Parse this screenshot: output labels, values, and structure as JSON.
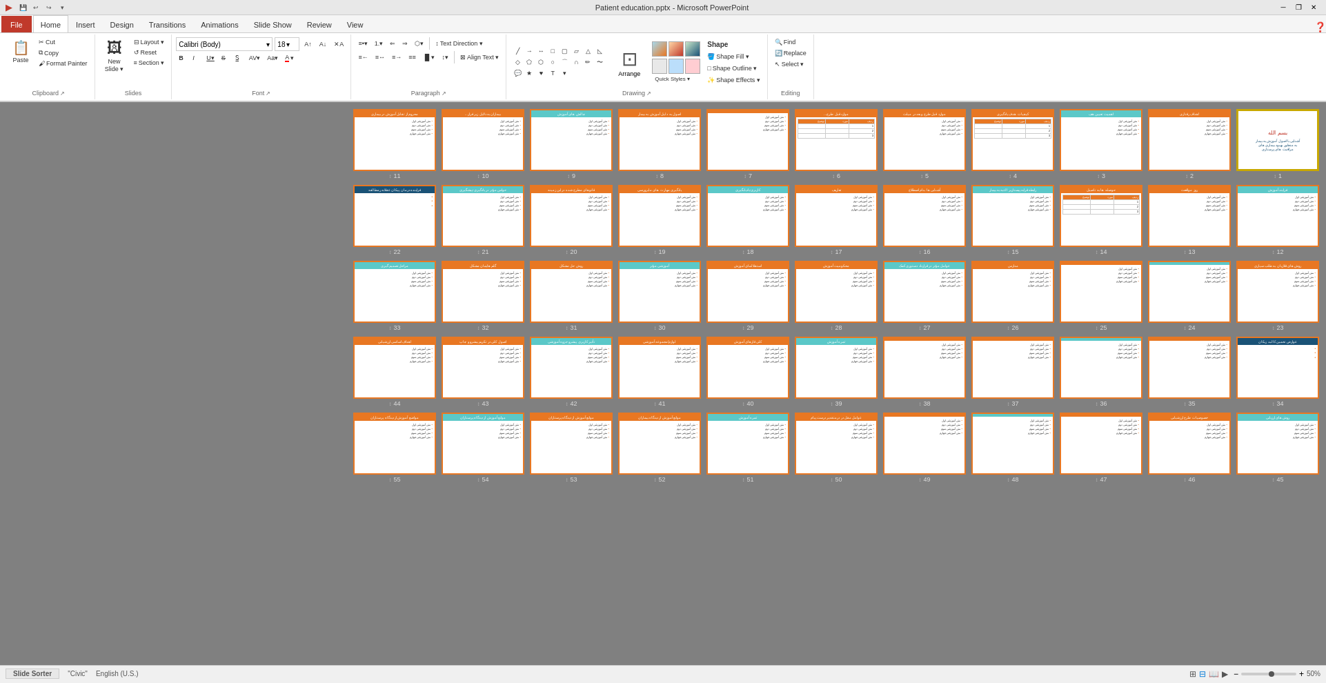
{
  "titleBar": {
    "title": "Patient education.pptx - Microsoft PowerPoint",
    "minBtn": "─",
    "maxBtn": "❐",
    "closeBtn": "✕",
    "qaButtons": [
      "💾",
      "↩",
      "↪",
      "▾"
    ]
  },
  "ribbonTabs": [
    {
      "label": "File",
      "isFile": true
    },
    {
      "label": "Home",
      "active": true
    },
    {
      "label": "Insert"
    },
    {
      "label": "Design"
    },
    {
      "label": "Transitions"
    },
    {
      "label": "Animations"
    },
    {
      "label": "Slide Show"
    },
    {
      "label": "Review"
    },
    {
      "label": "View"
    }
  ],
  "ribbon": {
    "groups": [
      {
        "name": "Clipboard",
        "items": [
          "Paste",
          "Cut",
          "Copy",
          "Format Painter"
        ]
      },
      {
        "name": "Slides",
        "items": [
          "New Slide",
          "Layout",
          "Reset",
          "Section"
        ]
      },
      {
        "name": "Font",
        "fontName": "Calibri",
        "fontSize": "18"
      },
      {
        "name": "Paragraph"
      },
      {
        "name": "Drawing"
      },
      {
        "name": "Editing",
        "items": [
          "Find",
          "Replace",
          "Select"
        ]
      }
    ]
  },
  "statusBar": {
    "slideSorter": "Slide Sorter",
    "civic": "\"Civic\"",
    "language": "English (U.S.)",
    "zoom": "50%",
    "viewButtons": [
      "normal",
      "slide-sorter",
      "reading-view",
      "slideshow"
    ]
  },
  "slides": [
    {
      "num": 1,
      "selected": true,
      "titleAr": "بسم الله",
      "type": "title-image"
    },
    {
      "num": 2,
      "titleAr": "اهداف رفتاری",
      "type": "content"
    },
    {
      "num": 3,
      "titleAr": "اهمیت تعیین هف",
      "type": "content"
    },
    {
      "num": 4,
      "titleAr": "کیفیات هدف یادگیری",
      "type": "table"
    },
    {
      "num": 5,
      "titleAr": "موارد قبل طرح و بعد در میلت",
      "type": "content"
    },
    {
      "num": 6,
      "titleAr": "موارد قبل طرح...",
      "type": "table"
    },
    {
      "num": 7,
      "titleAr": "",
      "type": "content"
    },
    {
      "num": 8,
      "titleAr": "اصول به دلیل آموزش به بیمار",
      "type": "content"
    },
    {
      "num": 9,
      "titleAr": "چالش های آموزش",
      "type": "content"
    },
    {
      "num": 10,
      "titleAr": "بیماران به دلایل زیر فرار...",
      "type": "content"
    },
    {
      "num": 11,
      "titleAr": "محروم از تقابل آموزش در بیماری",
      "type": "content"
    },
    {
      "num": 12,
      "titleAr": "فرایند آموزش",
      "type": "content"
    },
    {
      "num": 13,
      "titleAr": "روز مواقعت",
      "type": "content"
    },
    {
      "num": 14,
      "titleAr": "حوصله ها به تاصیل",
      "type": "table"
    },
    {
      "num": 15,
      "titleAr": "رابطه قرابه پیستاریر الثبه به بیمار",
      "type": "content"
    },
    {
      "num": 16,
      "titleAr": "آشنایی ها بنام اصطلاح",
      "type": "content"
    },
    {
      "num": 17,
      "titleAr": "تعاریف",
      "type": "content"
    },
    {
      "num": 18,
      "titleAr": "کاربری-یادیابگیری",
      "type": "content"
    },
    {
      "num": 19,
      "titleAr": "یادگیری مهارت های مایرورسی",
      "type": "content"
    },
    {
      "num": 20,
      "titleAr": "قانوهای مطرح شده در این زمینه",
      "type": "content"
    },
    {
      "num": 21,
      "titleAr": "حواس مؤثر در یادگیری-پیشگیری",
      "type": "content"
    },
    {
      "num": 22,
      "titleAr": "فراینده درمان پیکان عقلانه رمطالعه",
      "type": "content-blue"
    },
    {
      "num": 23,
      "titleAr": "روش های فلازیان به طلب سیاری",
      "type": "content"
    },
    {
      "num": 24,
      "titleAr": "",
      "type": "content"
    },
    {
      "num": 25,
      "titleAr": "",
      "type": "content"
    },
    {
      "num": 26,
      "titleAr": "مدارس",
      "type": "content"
    },
    {
      "num": 27,
      "titleAr": "عوامل مؤثر در قرارداد دستوری کمک",
      "type": "content"
    },
    {
      "num": 28,
      "titleAr": "محکومیت آموزش",
      "type": "content"
    },
    {
      "num": 29,
      "titleAr": "استقلالمای آموزش",
      "type": "content"
    },
    {
      "num": 30,
      "titleAr": "آموزشی مؤثر",
      "type": "content"
    },
    {
      "num": 31,
      "titleAr": "روش حل مشکل",
      "type": "content"
    },
    {
      "num": 32,
      "titleAr": "گلم هایمان مشکل",
      "type": "content"
    },
    {
      "num": 33,
      "titleAr": "مراحل تصمیم گیری",
      "type": "content"
    },
    {
      "num": 34,
      "titleAr": "عوارض تخمین کالبد زیکان",
      "type": "content-blue"
    },
    {
      "num": 35,
      "titleAr": "",
      "type": "content"
    },
    {
      "num": 36,
      "titleAr": "",
      "type": "content"
    },
    {
      "num": 37,
      "titleAr": "",
      "type": "content"
    },
    {
      "num": 38,
      "titleAr": "",
      "type": "content"
    },
    {
      "num": 39,
      "titleAr": "ثمره آموزش",
      "type": "content"
    },
    {
      "num": 40,
      "titleAr": "کلی قارهای آموزش",
      "type": "content"
    },
    {
      "num": 41,
      "titleAr": "لوازم/مجموعه آموزشی",
      "type": "content"
    },
    {
      "num": 42,
      "titleAr": "تأثیر کاربری پیشرو جزوه آموزشی",
      "type": "content"
    },
    {
      "num": 43,
      "titleAr": "اصول کلی در تکریم پیشرو و چاپ",
      "type": "content"
    },
    {
      "num": 44,
      "titleAr": "اهداف اساسی ارزشیابی",
      "type": "content"
    },
    {
      "num": 45,
      "titleAr": "روش های ارزیابی",
      "type": "content"
    },
    {
      "num": 46,
      "titleAr": "خصوصیات طرح ارزشیابی",
      "type": "content"
    },
    {
      "num": 47,
      "titleAr": "",
      "type": "content"
    },
    {
      "num": 48,
      "titleAr": "",
      "type": "content"
    },
    {
      "num": 49,
      "titleAr": "",
      "type": "content"
    },
    {
      "num": 50,
      "titleAr": "عوامل مقل در درمتقدیر درست پیام",
      "type": "content"
    },
    {
      "num": 51,
      "titleAr": "ثمره آموزش",
      "type": "content"
    },
    {
      "num": 52,
      "titleAr": "موانع آموزش از دیدگاه بیماران",
      "type": "content"
    },
    {
      "num": 53,
      "titleAr": "موانع آموزش از دیدگاه پرستاران",
      "type": "content"
    },
    {
      "num": 54,
      "titleAr": "موانع آموزش از دیدگاه پرستاران",
      "type": "content"
    },
    {
      "num": 55,
      "titleAr": "مواضع آموزش از دیدگاه پرستاران",
      "type": "content"
    }
  ]
}
